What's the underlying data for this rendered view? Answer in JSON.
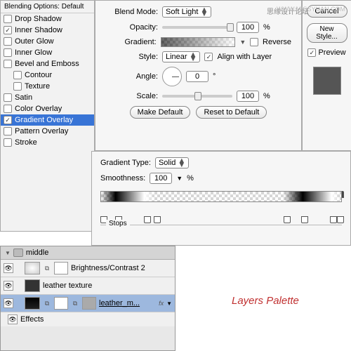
{
  "watermark": "思缘设计论坛",
  "watermark2": "WWW.MISSYUAN.COM",
  "stylesPanel": {
    "header": "Blending Options: Default",
    "items": [
      {
        "label": "Drop Shadow",
        "checked": false,
        "sub": false
      },
      {
        "label": "Inner Shadow",
        "checked": true,
        "sub": false
      },
      {
        "label": "Outer Glow",
        "checked": false,
        "sub": false
      },
      {
        "label": "Inner Glow",
        "checked": false,
        "sub": false
      },
      {
        "label": "Bevel and Emboss",
        "checked": false,
        "sub": false
      },
      {
        "label": "Contour",
        "checked": false,
        "sub": true
      },
      {
        "label": "Texture",
        "checked": false,
        "sub": true
      },
      {
        "label": "Satin",
        "checked": false,
        "sub": false
      },
      {
        "label": "Color Overlay",
        "checked": false,
        "sub": false
      },
      {
        "label": "Gradient Overlay",
        "checked": true,
        "sub": false,
        "selected": true
      },
      {
        "label": "Pattern Overlay",
        "checked": false,
        "sub": false
      },
      {
        "label": "Stroke",
        "checked": false,
        "sub": false
      }
    ]
  },
  "options": {
    "blendModeLabel": "Blend Mode:",
    "blendModeValue": "Soft Light",
    "opacityLabel": "Opacity:",
    "opacityValue": "100",
    "percent": "%",
    "gradientLabel": "Gradient:",
    "reverseLabel": "Reverse",
    "reverseChecked": false,
    "styleLabel": "Style:",
    "styleValue": "Linear",
    "alignLabel": "Align with Layer",
    "alignChecked": true,
    "angleLabel": "Angle:",
    "angleValue": "0",
    "degree": "°",
    "scaleLabel": "Scale:",
    "scaleValue": "100",
    "makeDefault": "Make Default",
    "resetDefault": "Reset to Default"
  },
  "right": {
    "cancel": "Cancel",
    "newStyle": "New Style...",
    "preview": "Preview",
    "previewChecked": true
  },
  "gradEditor": {
    "typeLabel": "Gradient Type:",
    "typeValue": "Solid",
    "smoothLabel": "Smoothness:",
    "smoothValue": "100",
    "percent": "%",
    "stopsLabel": "Stops"
  },
  "layers": {
    "group": "middle",
    "rows": [
      {
        "name": "Brightness/Contrast 2",
        "sel": false
      },
      {
        "name": "leather texture",
        "sel": false
      },
      {
        "name": "leather_m...",
        "sel": true
      }
    ],
    "effects": "Effects",
    "fx": "fx"
  },
  "canvasLabel": "Layers Palette"
}
